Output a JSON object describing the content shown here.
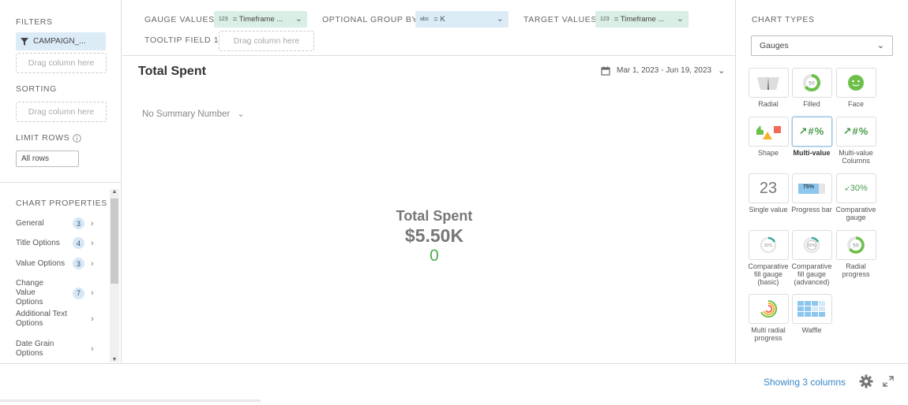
{
  "left": {
    "filters_title": "FILTERS",
    "filter_chip": "CAMPAIGN_...",
    "drag_placeholder": "Drag column here",
    "sorting_title": "SORTING",
    "sorting_drag": "Drag column here",
    "limit_title": "LIMIT ROWS",
    "limit_value": "All rows",
    "props_title": "CHART PROPERTIES",
    "props": [
      {
        "label": "General",
        "count": "3"
      },
      {
        "label": "Title Options",
        "count": "4"
      },
      {
        "label": "Value Options",
        "count": "3"
      },
      {
        "label": "Change Value Options",
        "count": "7"
      },
      {
        "label": "Additional Text Options",
        "count": ""
      },
      {
        "label": "Date Grain Options",
        "count": ""
      }
    ]
  },
  "topbar": {
    "gauge_label": "GAUGE VALUES",
    "gauge_chip": "= Timeframe ...",
    "gauge_type": "123",
    "group_label": "OPTIONAL GROUP BY",
    "group_chip": "= K",
    "group_type": "abc",
    "target_label": "TARGET VALUES",
    "target_chip": "= Timeframe ...",
    "target_type": "123",
    "tooltip_label": "TOOLTIP FIELD 1",
    "tooltip_drag": "Drag column here"
  },
  "main": {
    "title": "Total Spent",
    "date_range": "Mar 1, 2023 - Jun 19, 2023",
    "summary": "No Summary Number",
    "gauge_title": "Total Spent",
    "gauge_value": "$5.50K",
    "gauge_change": "0"
  },
  "right": {
    "title": "CHART TYPES",
    "selected": "Gauges",
    "types": [
      {
        "label": "Radial",
        "icon": "radial-icon"
      },
      {
        "label": "Filled",
        "icon": "filled-icon"
      },
      {
        "label": "Face",
        "icon": "face-icon"
      },
      {
        "label": "Shape",
        "icon": "shape-icon"
      },
      {
        "label": "Multi-value",
        "icon": "multi-value-icon",
        "icon_text": "↗#%"
      },
      {
        "label": "Multi-value Columns",
        "icon": "multi-value-columns-icon",
        "icon_text": "↗#%"
      },
      {
        "label": "Single value",
        "icon": "single-value-icon",
        "icon_text": "23"
      },
      {
        "label": "Progress bar",
        "icon": "progress-bar-icon",
        "icon_text": "75%"
      },
      {
        "label": "Comparative gauge",
        "icon": "comparative-gauge-icon",
        "icon_text": "30%"
      },
      {
        "label": "Comparative fill gauge (basic)",
        "icon": "comparative-fill-basic-icon",
        "icon_text": "30%"
      },
      {
        "label": "Comparative fill gauge (advanced)",
        "icon": "comparative-fill-advanced-icon",
        "icon_text": "30%"
      },
      {
        "label": "Radial progress",
        "icon": "radial-progress-icon",
        "icon_text": "50"
      },
      {
        "label": "Multi radial progress",
        "icon": "multi-radial-progress-icon"
      },
      {
        "label": "Waffle",
        "icon": "waffle-icon"
      }
    ]
  },
  "bottom": {
    "showing": "Showing 3 columns"
  },
  "colors": {
    "accent_blue": "#3a86c8",
    "chip_blue": "#dcecf7",
    "chip_green": "#d9eee4",
    "positive_green": "#4caf50"
  }
}
